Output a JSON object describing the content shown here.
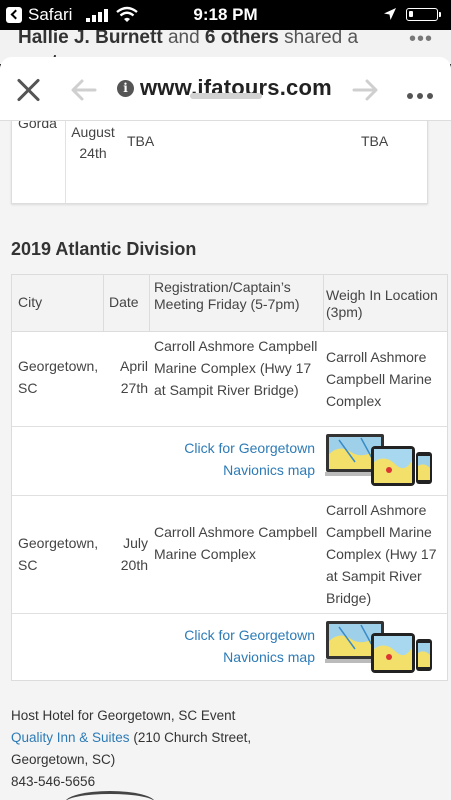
{
  "status_bar": {
    "back_app": "Safari",
    "time": "9:18 PM"
  },
  "behind_page": {
    "line1_bold_a": "Hallie J. Burnett",
    "line1_and": "and",
    "line1_bold_b": "6 others",
    "line1_rest": "shared a",
    "line2": "post"
  },
  "browser": {
    "url": "www.ifatours.com"
  },
  "top_partial_row": {
    "city": "Gorda",
    "date": "August 24th",
    "registration": "TBA",
    "weigh_in": "TBA"
  },
  "section_title": "2019 Atlantic Division",
  "table": {
    "headers": {
      "city": "City",
      "date": "Date",
      "registration": "Registration/Captain’s Meeting Friday (5-7pm)",
      "weigh_in": "Weigh In Location (3pm)"
    },
    "rows": [
      {
        "city": "Georgetown, SC",
        "date": "April 27th",
        "registration": "Carroll Ashmore Campbell Marine Complex (Hwy 17 at Sampit River Bridge)",
        "weigh_in": "Carroll Ashmore Campbell Marine Complex",
        "map_link": "Click for Georgetown Navionics map"
      },
      {
        "city": "Georgetown, SC",
        "date": "July 20th",
        "registration": "Carroll Ashmore Campbell Marine Complex",
        "weigh_in": "Carroll Ashmore Campbell Marine Complex (Hwy 17 at Sampit River Bridge)",
        "map_link": "Click for Georgetown Navionics map"
      }
    ]
  },
  "host_hotel": {
    "heading": "Host Hotel for Georgetown, SC Event",
    "link": "Quality Inn & Suites",
    "address_a": "(210 Church Street,",
    "address_b": "Georgetown, SC)",
    "phone": "843-546-5656"
  },
  "colors": {
    "link": "#2d7bb6",
    "text": "#444444",
    "header_bg": "#f3f3f3"
  },
  "icons": [
    "back-arrow-icon",
    "signal-icon",
    "wifi-icon",
    "location-icon",
    "battery-icon",
    "close-icon",
    "nav-back-icon",
    "info-icon",
    "nav-forward-icon",
    "more-icon"
  ]
}
